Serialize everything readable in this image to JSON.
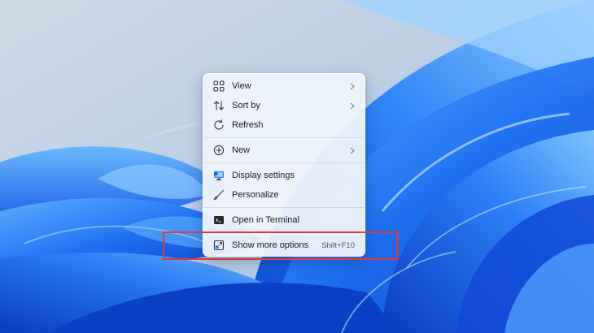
{
  "menu": {
    "items": [
      {
        "label": "View",
        "icon": "grid-icon",
        "submenu": true
      },
      {
        "label": "Sort by",
        "icon": "sort-arrows-icon",
        "submenu": true
      },
      {
        "label": "Refresh",
        "icon": "refresh-icon",
        "submenu": false
      },
      {
        "label": "New",
        "icon": "plus-circle-icon",
        "submenu": true
      },
      {
        "label": "Display settings",
        "icon": "display-icon",
        "submenu": false
      },
      {
        "label": "Personalize",
        "icon": "brush-icon",
        "submenu": false
      },
      {
        "label": "Open in Terminal",
        "icon": "terminal-icon",
        "submenu": false
      },
      {
        "label": "Show more options",
        "icon": "expand-window-icon",
        "submenu": false,
        "shortcut": "Shift+F10"
      }
    ]
  },
  "annotation": {
    "color": "#e0393c",
    "target": "Show more options"
  },
  "colors": {
    "wallpaper_accent": "#1f6fe8",
    "menu_background": "#eef3fb"
  }
}
